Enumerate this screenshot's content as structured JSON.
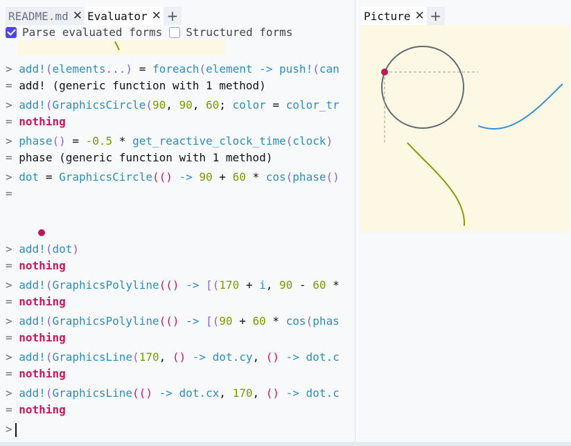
{
  "tabs_left": [
    {
      "label": "README.md",
      "active": false
    },
    {
      "label": "Evaluator",
      "active": true
    }
  ],
  "tabs_right": [
    {
      "label": "Picture",
      "active": true
    }
  ],
  "tab_close_glyph": "✕",
  "tab_add_glyph": "+",
  "options": {
    "parse_evaluated": {
      "label": "Parse evaluated forms",
      "checked": true
    },
    "structured": {
      "label": "Structured forms",
      "checked": false
    }
  },
  "prompt_symbol": ">",
  "result_symbol": "=",
  "entries": [
    {
      "input": "add!(elements...) = foreach(element -> push!(can",
      "result": "add! (generic function with 1 method)"
    },
    {
      "input": "add!(GraphicsCircle(90, 90, 60; color = color_tr",
      "result": "nothing"
    },
    {
      "input": "phase() = -0.5 * get_reactive_clock_time(clock)",
      "result": "phase (generic function with 1 method)"
    },
    {
      "input": "dot = GraphicsCircle(() -> 90 + 60 * cos(phase()",
      "result": ""
    },
    {
      "input": "add!(dot)",
      "result": "nothing"
    },
    {
      "input": "add!(GraphicsPolyline(() -> [(170 + i, 90 - 60 *",
      "result": "nothing"
    },
    {
      "input": "add!(GraphicsPolyline(() -> [(90 + 60 * cos(phas",
      "result": "nothing"
    },
    {
      "input": "add!(GraphicsLine(170, () -> dot.cy, () -> dot.c",
      "result": "nothing"
    },
    {
      "input": "add!(GraphicsLine(() -> dot.cx, 170, () -> dot.c",
      "result": "nothing"
    }
  ],
  "colors": {
    "accent": "#4f46e5",
    "function": "#2b8cbe",
    "punctuation": "#8a63d2",
    "number": "#7a9a01",
    "keyword_nothing": "#c2185b",
    "picture_bg": "#fdf8e4",
    "circle": "#5f6b73",
    "sine_top": "#3a8fd0",
    "sine_bottom": "#8a9a00",
    "dot": "#c2185b"
  }
}
